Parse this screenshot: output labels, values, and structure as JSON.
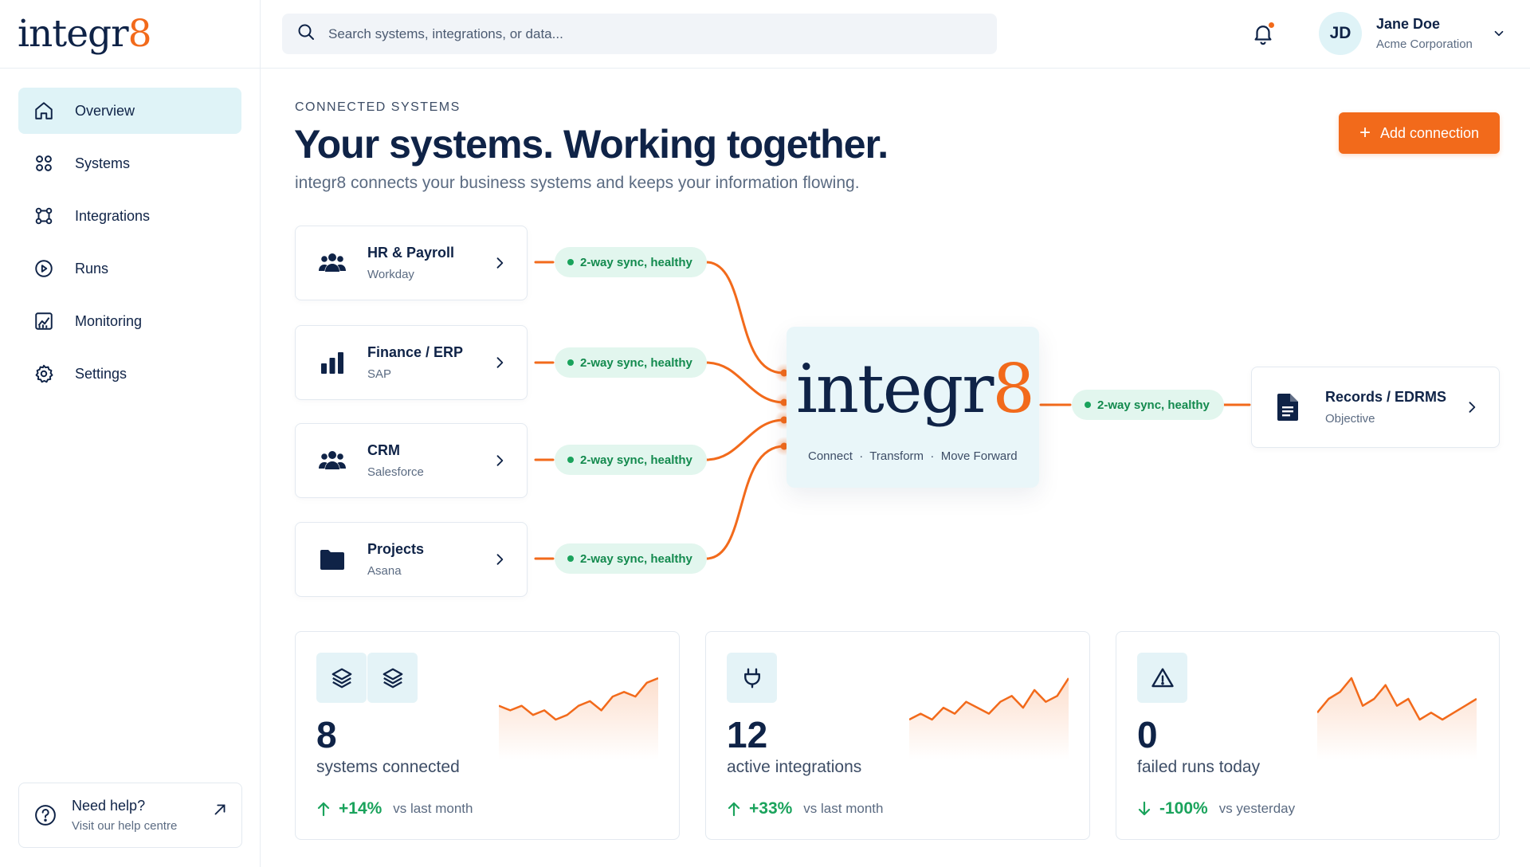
{
  "app": {
    "logo_text": "integr",
    "logo_eight": "8"
  },
  "sidebar": {
    "items": [
      {
        "label": "Overview",
        "icon": "home-icon",
        "active": true
      },
      {
        "label": "Systems",
        "icon": "grid-icon"
      },
      {
        "label": "Integrations",
        "icon": "integrations-icon"
      },
      {
        "label": "Runs",
        "icon": "play-circle-icon"
      },
      {
        "label": "Monitoring",
        "icon": "chart-icon"
      },
      {
        "label": "Settings",
        "icon": "gear-icon"
      }
    ],
    "help": {
      "title": "Need help?",
      "subtitle": "Visit our help centre"
    }
  },
  "topbar": {
    "search_placeholder": "Search systems, integrations, or data...",
    "user": {
      "initials": "JD",
      "name": "Jane Doe",
      "org": "Acme Corporation"
    }
  },
  "header": {
    "eyebrow": "CONNECTED SYSTEMS",
    "title": "Your systems. Working together.",
    "subtitle": "integr8 connects your business systems and keeps your information flowing.",
    "add_button": "Add connection"
  },
  "systems": [
    {
      "name": "HR & Payroll",
      "vendor": "Workday",
      "icon": "people-icon",
      "status": "2-way sync, healthy"
    },
    {
      "name": "Finance / ERP",
      "vendor": "SAP",
      "icon": "bar-chart-icon",
      "status": "2-way sync, healthy"
    },
    {
      "name": "CRM",
      "vendor": "Salesforce",
      "icon": "people-icon",
      "status": "2-way sync, healthy"
    },
    {
      "name": "Projects",
      "vendor": "Asana",
      "icon": "folder-icon",
      "status": "2-way sync, healthy"
    }
  ],
  "hub": {
    "logo_text": "integr",
    "logo_eight": "8",
    "tagline": "Connect  ·  Transform  ·  Move Forward"
  },
  "destination": {
    "name": "Records / EDRMS",
    "vendor": "Objective",
    "icon": "document-icon",
    "status": "2-way sync, healthy"
  },
  "stats": [
    {
      "value": "8",
      "label": "systems connected",
      "delta": "+14%",
      "comparison": "vs last month",
      "direction": "up",
      "trend": [
        6,
        5,
        6,
        4,
        5,
        3,
        4,
        6,
        7,
        5,
        8,
        9,
        8,
        11,
        12
      ]
    },
    {
      "value": "12",
      "label": "active integrations",
      "delta": "+33%",
      "comparison": "vs last month",
      "direction": "up",
      "trend": [
        6,
        7,
        6,
        8,
        7,
        9,
        8,
        7,
        9,
        10,
        8,
        11,
        9,
        10,
        13
      ]
    },
    {
      "value": "0",
      "label": "failed runs today",
      "delta": "-100%",
      "comparison": "vs yesterday",
      "direction": "down",
      "trend": [
        9,
        11,
        12,
        14,
        10,
        11,
        13,
        10,
        11,
        8,
        9,
        8,
        9,
        10,
        11
      ]
    }
  ],
  "colors": {
    "brand_navy": "#0f2347",
    "accent_orange": "#f26a1b",
    "healthy_green": "#1aa35c",
    "hub_bg": "#e9f6f9"
  }
}
